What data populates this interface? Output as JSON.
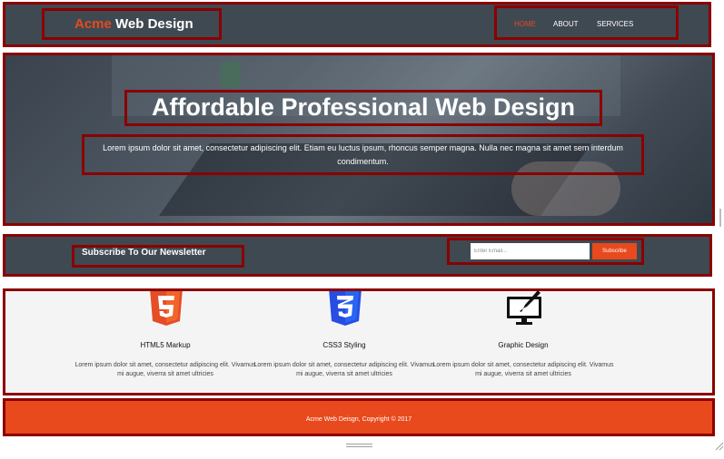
{
  "header": {
    "brand_accent": "Acme",
    "brand_rest": "Web Design",
    "nav": [
      {
        "label": "HOME",
        "active": true
      },
      {
        "label": "ABOUT",
        "active": false
      },
      {
        "label": "SERVICES",
        "active": false
      }
    ]
  },
  "hero": {
    "title": "Affordable Professional Web Design",
    "text": "Lorem ipsum dolor sit amet, consectetur adipiscing elit. Etiam eu luctus ipsum, rhoncus semper magna. Nulla nec magna sit amet sem interdum condimentum."
  },
  "newsletter": {
    "title": "Subscribe To Our Newsletter",
    "placeholder": "Enter Email...",
    "button": "Subscribe"
  },
  "features": [
    {
      "icon": "html5-icon",
      "title": "HTML5 Markup",
      "text": "Lorem ipsum dolor sit amet, consectetur adipiscing elit. Vivamus mi augue, viverra sit amet ultricies"
    },
    {
      "icon": "css3-icon",
      "title": "CSS3 Styling",
      "text": "Lorem ipsum dolor sit amet, consectetur adipiscing elit. Vivamus mi augue, viverra sit amet ultricies"
    },
    {
      "icon": "graphic-design-icon",
      "title": "Graphic Design",
      "text": "Lorem ipsum dolor sit amet, consectetur adipiscing elit. Vivamus mi augue, viverra sit amet ultricies"
    }
  ],
  "footer": {
    "text": "Acme Web Deisgn, Copyright © 2017"
  },
  "colors": {
    "accent": "#e8491d",
    "header_bg": "#3f4952",
    "annotation_frame": "#8b0000",
    "features_bg": "#f4f4f4",
    "html5": "#e44d26",
    "css3": "#264de4"
  }
}
